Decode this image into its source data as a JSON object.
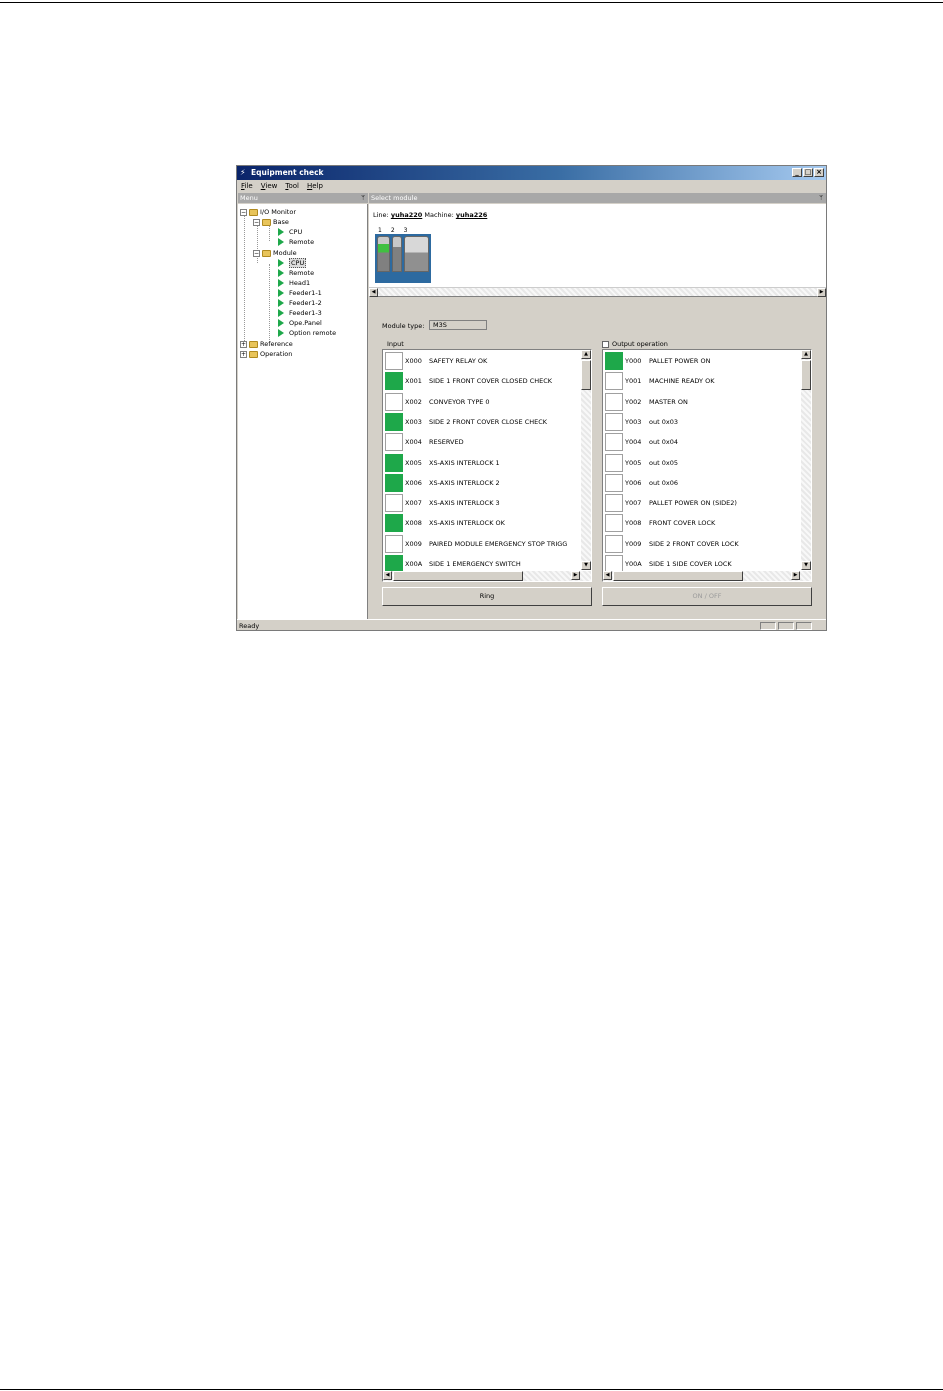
{
  "window": {
    "title": "Equipment check",
    "minimize": "_",
    "maximize": "□",
    "close": "×"
  },
  "menu": [
    "File",
    "View",
    "Tool",
    "Help"
  ],
  "left_panel": {
    "header": "Menu",
    "pin": "ᛘ",
    "tree": {
      "root": "I/O Monitor",
      "base": "Base",
      "base_items": [
        "CPU",
        "Remote"
      ],
      "module": "Module",
      "module_items": [
        "CPU",
        "Remote",
        "Head1",
        "Feeder1-1",
        "Feeder1-2",
        "Feeder1-3",
        "Ope.Panel",
        "Option remote"
      ],
      "reference": "Reference",
      "operation": "Operation"
    }
  },
  "right_panel": {
    "header": "Select module",
    "pin": "ᛘ",
    "line_label": "Line:",
    "line_value": "yuha220",
    "machine_label": "Machine:",
    "machine_value": "yuha226",
    "module_numbers": [
      "1",
      "2",
      "3"
    ],
    "module_type_label": "Module type:",
    "module_type_value": "M3S"
  },
  "input": {
    "label": "Input",
    "rows": [
      {
        "addr": "X000",
        "desc": "SAFETY RELAY OK",
        "on": false
      },
      {
        "addr": "X001",
        "desc": "SIDE 1 FRONT COVER CLOSED CHECK",
        "on": true
      },
      {
        "addr": "X002",
        "desc": "CONVEYOR TYPE 0",
        "on": false
      },
      {
        "addr": "X003",
        "desc": "SIDE 2 FRONT COVER CLOSE CHECK",
        "on": true
      },
      {
        "addr": "X004",
        "desc": "RESERVED",
        "on": false
      },
      {
        "addr": "X005",
        "desc": "XS-AXIS INTERLOCK 1",
        "on": true
      },
      {
        "addr": "X006",
        "desc": "XS-AXIS INTERLOCK 2",
        "on": true
      },
      {
        "addr": "X007",
        "desc": "XS-AXIS INTERLOCK 3",
        "on": false
      },
      {
        "addr": "X008",
        "desc": "XS-AXIS INTERLOCK OK",
        "on": true
      },
      {
        "addr": "X009",
        "desc": "PAIRED MODULE EMERGENCY STOP TRIGG",
        "on": false
      },
      {
        "addr": "X00A",
        "desc": "SIDE 1 EMERGENCY SWITCH",
        "on": true
      }
    ]
  },
  "output": {
    "label": "Output operation",
    "rows": [
      {
        "addr": "Y000",
        "desc": "PALLET POWER ON",
        "on": true
      },
      {
        "addr": "Y001",
        "desc": "MACHINE READY OK",
        "on": false
      },
      {
        "addr": "Y002",
        "desc": "MASTER ON",
        "on": false
      },
      {
        "addr": "Y003",
        "desc": "out 0x03",
        "on": false
      },
      {
        "addr": "Y004",
        "desc": "out 0x04",
        "on": false
      },
      {
        "addr": "Y005",
        "desc": "out 0x05",
        "on": false
      },
      {
        "addr": "Y006",
        "desc": "out 0x06",
        "on": false
      },
      {
        "addr": "Y007",
        "desc": "PALLET POWER ON (SIDE2)",
        "on": false
      },
      {
        "addr": "Y008",
        "desc": "FRONT COVER LOCK",
        "on": false
      },
      {
        "addr": "Y009",
        "desc": "SIDE 2 FRONT COVER LOCK",
        "on": false
      },
      {
        "addr": "Y00A",
        "desc": "SIDE 1 SIDE COVER LOCK",
        "on": false
      }
    ]
  },
  "buttons": {
    "ring": "Ring",
    "onoff": "ON / OFF"
  },
  "status": "Ready",
  "colors": {
    "lamp_on": "#1ea84a",
    "titlebar": "#0a246a"
  }
}
